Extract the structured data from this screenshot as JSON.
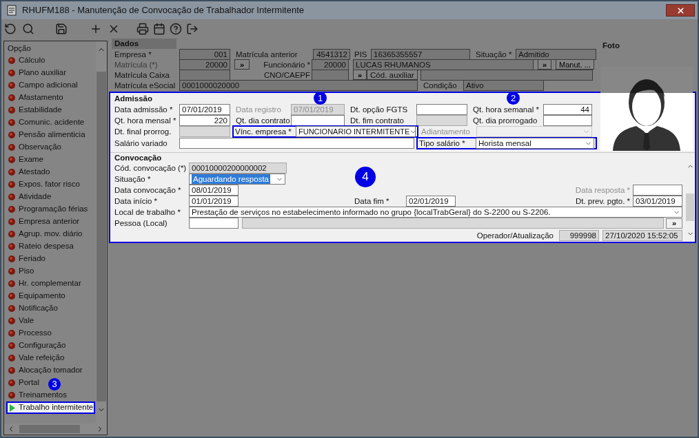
{
  "window": {
    "title": "RHUFM188 - Manutenção de Convocação de Trabalhador Intermitente"
  },
  "sidebar": {
    "title": "Opção",
    "items": [
      {
        "label": "Cálculo",
        "selected": false
      },
      {
        "label": "Plano auxiliar",
        "selected": false
      },
      {
        "label": "Campo adicional",
        "selected": false
      },
      {
        "label": "Afastamento",
        "selected": false
      },
      {
        "label": "Estabilidade",
        "selected": false
      },
      {
        "label": "Comunic. acidente",
        "selected": false
      },
      {
        "label": "Pensão alimenticia",
        "selected": false
      },
      {
        "label": "Observação",
        "selected": false
      },
      {
        "label": "Exame",
        "selected": false
      },
      {
        "label": "Atestado",
        "selected": false
      },
      {
        "label": "Expos. fator risco",
        "selected": false
      },
      {
        "label": "Atividade",
        "selected": false
      },
      {
        "label": "Programação férias",
        "selected": false
      },
      {
        "label": "Empresa anterior",
        "selected": false
      },
      {
        "label": "Agrup. mov. diário",
        "selected": false
      },
      {
        "label": "Rateio despesa",
        "selected": false
      },
      {
        "label": "Feriado",
        "selected": false
      },
      {
        "label": "Piso",
        "selected": false
      },
      {
        "label": "Hr. complementar",
        "selected": false
      },
      {
        "label": "Equipamento",
        "selected": false
      },
      {
        "label": "Notificação",
        "selected": false
      },
      {
        "label": "Vale",
        "selected": false
      },
      {
        "label": "Processo",
        "selected": false
      },
      {
        "label": "Configuração",
        "selected": false
      },
      {
        "label": "Vale refeição",
        "selected": false
      },
      {
        "label": "Alocação tomador",
        "selected": false
      },
      {
        "label": "Portal",
        "selected": false
      },
      {
        "label": "Treinamentos",
        "selected": false
      },
      {
        "label": "Trabalho intermitente",
        "selected": true
      }
    ]
  },
  "dados": {
    "title": "Dados",
    "empresa": {
      "label": "Empresa *",
      "value": "001"
    },
    "matricula_anterior": {
      "label": "Matrícula anterior",
      "value": "4541312"
    },
    "pis": {
      "label": "PIS",
      "value": "16365355557"
    },
    "situacao": {
      "label": "Situação *",
      "value": "Admitido"
    },
    "matricula": {
      "label": "Matrícula (*)",
      "value": "20000",
      "button": "»",
      "disabled": true
    },
    "funcionario": {
      "label": "Funcionário *",
      "value": "20000",
      "name": "LUCAS RHUMANOS",
      "button": "»"
    },
    "manut_button": "Manut. ...",
    "matricula_caixa": {
      "label": "Matrícula Caixa"
    },
    "cno_caepf": {
      "label": "CNO/CAEPF"
    },
    "cod_auxiliar": {
      "label": "Cód. auxiliar",
      "button": "»"
    },
    "matricula_esocial": {
      "label": "Matrícula eSocial",
      "value": "0001000020000"
    },
    "condicao": {
      "label": "Condição",
      "value": "Ativo"
    }
  },
  "foto": {
    "title": "Foto"
  },
  "admissao": {
    "title": "Admissão",
    "data_admissao": {
      "label": "Data admissão *",
      "value": "07/01/2019"
    },
    "data_registro": {
      "label": "Data registro",
      "value": "07/01/2019",
      "disabled": true
    },
    "dt_opcao_fgts": {
      "label": "Dt. opção FGTS"
    },
    "qt_hora_semanal": {
      "label": "Qt. hora semanal *",
      "value": "44"
    },
    "qt_hora_mensal": {
      "label": "Qt. hora mensal *",
      "value": "220"
    },
    "qt_dia_contrato": {
      "label": "Qt. dia contrato"
    },
    "dt_fim_contrato": {
      "label": "Dt. fim contrato",
      "disabled": true
    },
    "qt_dia_prorrogado": {
      "label": "Qt. dia prorrogado"
    },
    "dt_final_prorrog": {
      "label": "Dt. final prorrog.",
      "disabled": true
    },
    "vinc_empresa": {
      "label": "Vínc. empresa *",
      "value": "FUNCIONARIO INTERMITENTE"
    },
    "adiantamento": {
      "label": "Adiantamento",
      "disabled": true
    },
    "salario_variado": {
      "label": "Salário variado"
    },
    "tipo_salario": {
      "label": "Tipo salário *",
      "value": "Horista mensal"
    }
  },
  "convocacao": {
    "title": "Convocação",
    "cod_convocacao": {
      "label": "Cód. convocação (*)",
      "value": "00010000200000002",
      "disabled": true
    },
    "situacao": {
      "label": "Situação *",
      "value": "Aguardando resposta"
    },
    "data_convocacao": {
      "label": "Data convocação *",
      "value": "08/01/2019"
    },
    "data_resposta": {
      "label": "Data resposta *",
      "disabled": true
    },
    "data_inicio": {
      "label": "Data início *",
      "value": "01/01/2019"
    },
    "data_fim": {
      "label": "Data fim *",
      "value": "02/01/2019"
    },
    "dt_prev_pgto": {
      "label": "Dt. prev. pgto. *",
      "value": "03/01/2019"
    },
    "local_trabalho": {
      "label": "Local de trabalho *",
      "value": "Prestação de serviços no estabelecimento informado no grupo {localTrabGeral} do S-2200 ou S-2206."
    },
    "pessoa": {
      "label": "Pessoa (Local)",
      "button": "»"
    },
    "operador": {
      "label": "Operador/Atualização",
      "value": "999998",
      "updated": "27/10/2020 15:52:05"
    }
  },
  "callouts": [
    {
      "label": "1"
    },
    {
      "label": "2"
    },
    {
      "label": "3"
    },
    {
      "label": "4"
    }
  ]
}
